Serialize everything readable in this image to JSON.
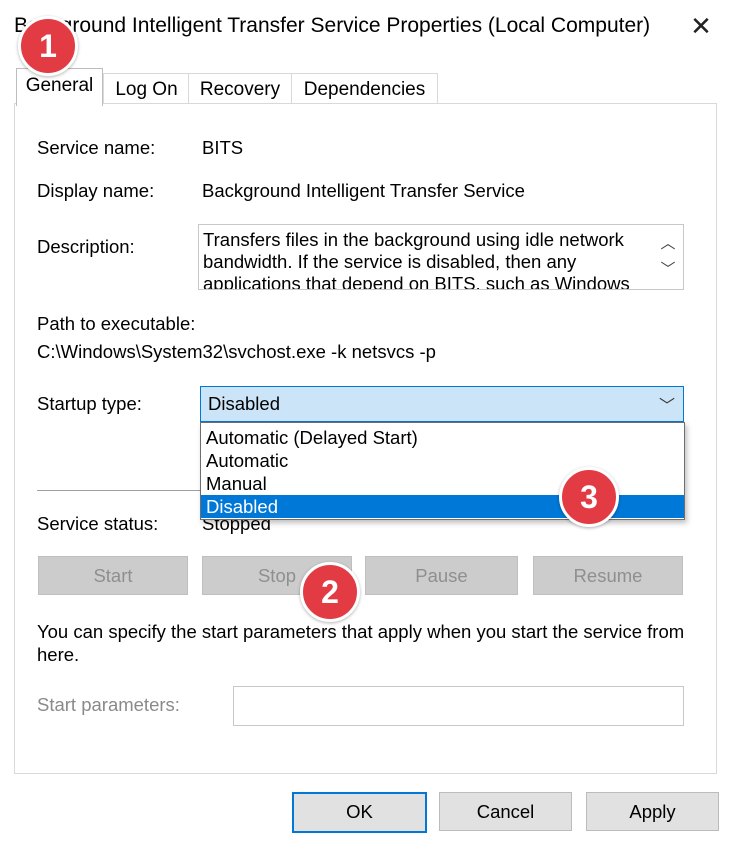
{
  "window": {
    "title": "Background Intelligent Transfer Service Properties (Local Computer)",
    "close_glyph": "✕"
  },
  "tabs": [
    {
      "label": "General",
      "active": true
    },
    {
      "label": "Log On",
      "active": false
    },
    {
      "label": "Recovery",
      "active": false
    },
    {
      "label": "Dependencies",
      "active": false
    }
  ],
  "general": {
    "service_name_label": "Service name:",
    "service_name_value": "BITS",
    "display_name_label": "Display name:",
    "display_name_value": "Background Intelligent Transfer Service",
    "description_label": "Description:",
    "description_value": "Transfers files in the background using idle network bandwidth. If the service is disabled, then any applications that depend on BITS, such as Windows",
    "path_label": "Path to executable:",
    "path_value": "C:\\Windows\\System32\\svchost.exe -k netsvcs -p",
    "startup_type_label": "Startup type:",
    "startup_type_value": "Disabled",
    "startup_options": [
      "Automatic (Delayed Start)",
      "Automatic",
      "Manual",
      "Disabled"
    ],
    "startup_selected_index": 3,
    "service_status_label": "Service status:",
    "service_status_value": "Stopped",
    "buttons": {
      "start": "Start",
      "stop": "Stop",
      "pause": "Pause",
      "resume": "Resume"
    },
    "hint_text": "You can specify the start parameters that apply when you start the service from here.",
    "start_params_label": "Start parameters:",
    "start_params_value": ""
  },
  "footer": {
    "ok": "OK",
    "cancel": "Cancel",
    "apply": "Apply"
  },
  "annotations": {
    "badge1": "1",
    "badge2": "2",
    "badge3": "3",
    "color": "#e23b44"
  },
  "colors": {
    "accent": "#0078d7",
    "select_bg": "#cce4f7"
  }
}
